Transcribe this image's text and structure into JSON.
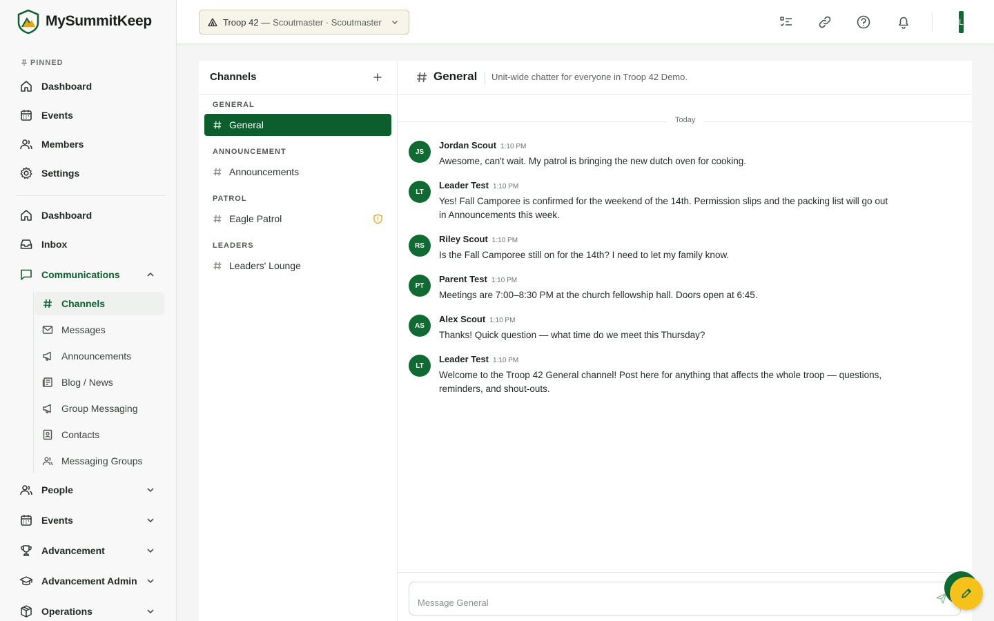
{
  "app": {
    "name": "MySummitKeep"
  },
  "sidebar": {
    "pinned_label": "PINNED",
    "pinned": [
      {
        "label": "Dashboard",
        "icon": "home-icon"
      },
      {
        "label": "Events",
        "icon": "calendar-icon"
      },
      {
        "label": "Members",
        "icon": "users-icon"
      },
      {
        "label": "Settings",
        "icon": "gear-icon"
      }
    ],
    "main": [
      {
        "label": "Dashboard",
        "icon": "home-icon"
      },
      {
        "label": "Inbox",
        "icon": "inbox-icon"
      },
      {
        "label": "Communications",
        "icon": "chat-icon",
        "expanded": true
      }
    ],
    "communications_sub": [
      {
        "label": "Channels",
        "icon": "hash-icon",
        "active": true
      },
      {
        "label": "Messages",
        "icon": "mail-icon"
      },
      {
        "label": "Announcements",
        "icon": "megaphone-icon"
      },
      {
        "label": "Blog / News",
        "icon": "newspaper-icon"
      },
      {
        "label": "Group Messaging",
        "icon": "megaphone-icon"
      },
      {
        "label": "Contacts",
        "icon": "contact-icon"
      },
      {
        "label": "Messaging Groups",
        "icon": "users-icon"
      }
    ],
    "sections": [
      {
        "label": "People",
        "icon": "users-icon"
      },
      {
        "label": "Events",
        "icon": "calendar-icon"
      },
      {
        "label": "Advancement",
        "icon": "trophy-icon"
      },
      {
        "label": "Advancement Admin",
        "icon": "graduation-cap-icon"
      },
      {
        "label": "Operations",
        "icon": "box-icon"
      }
    ]
  },
  "topbar": {
    "unit_name": "Troop 42 —",
    "unit_role": "Scoutmaster · Scoutmaster",
    "avatar_initial": "L"
  },
  "channels": {
    "title": "Channels",
    "groups": [
      {
        "label": "GENERAL",
        "items": [
          {
            "name": "General",
            "active": true
          }
        ]
      },
      {
        "label": "ANNOUNCEMENT",
        "items": [
          {
            "name": "Announcements"
          }
        ]
      },
      {
        "label": "PATROL",
        "items": [
          {
            "name": "Eagle Patrol",
            "badge": "shield-icon"
          }
        ]
      },
      {
        "label": "LEADERS",
        "items": [
          {
            "name": "Leaders' Lounge"
          }
        ]
      }
    ]
  },
  "chat": {
    "channel_name": "General",
    "description": "Unit-wide chatter for everyone in Troop 42 Demo.",
    "day_label": "Today",
    "messages": [
      {
        "initials": "JS",
        "author": "Jordan Scout",
        "time": "1:10 PM",
        "text": "Awesome, can't wait. My patrol is bringing the new dutch oven for cooking."
      },
      {
        "initials": "LT",
        "author": "Leader Test",
        "time": "1:10 PM",
        "text": "Yes! Fall Camporee is confirmed for the weekend of the 14th. Permission slips and the packing list will go out in Announcements this week."
      },
      {
        "initials": "RS",
        "author": "Riley Scout",
        "time": "1:10 PM",
        "text": "Is the Fall Camporee still on for the 14th? I need to let my family know."
      },
      {
        "initials": "PT",
        "author": "Parent Test",
        "time": "1:10 PM",
        "text": "Meetings are 7:00–8:30 PM at the church fellowship hall. Doors open at 6:45."
      },
      {
        "initials": "AS",
        "author": "Alex Scout",
        "time": "1:10 PM",
        "text": "Thanks! Quick question — what time do we meet this Thursday?"
      },
      {
        "initials": "LT",
        "author": "Leader Test",
        "time": "1:10 PM",
        "text": "Welcome to the Troop 42 General channel! Post here for anything that affects the whole troop — questions, reminders, and shout-outs."
      }
    ],
    "composer_placeholder": "Message General"
  },
  "colors": {
    "brand_green": "#0c5e2c",
    "accent_yellow": "#f4c21b",
    "warning_amber": "#e8a317"
  }
}
